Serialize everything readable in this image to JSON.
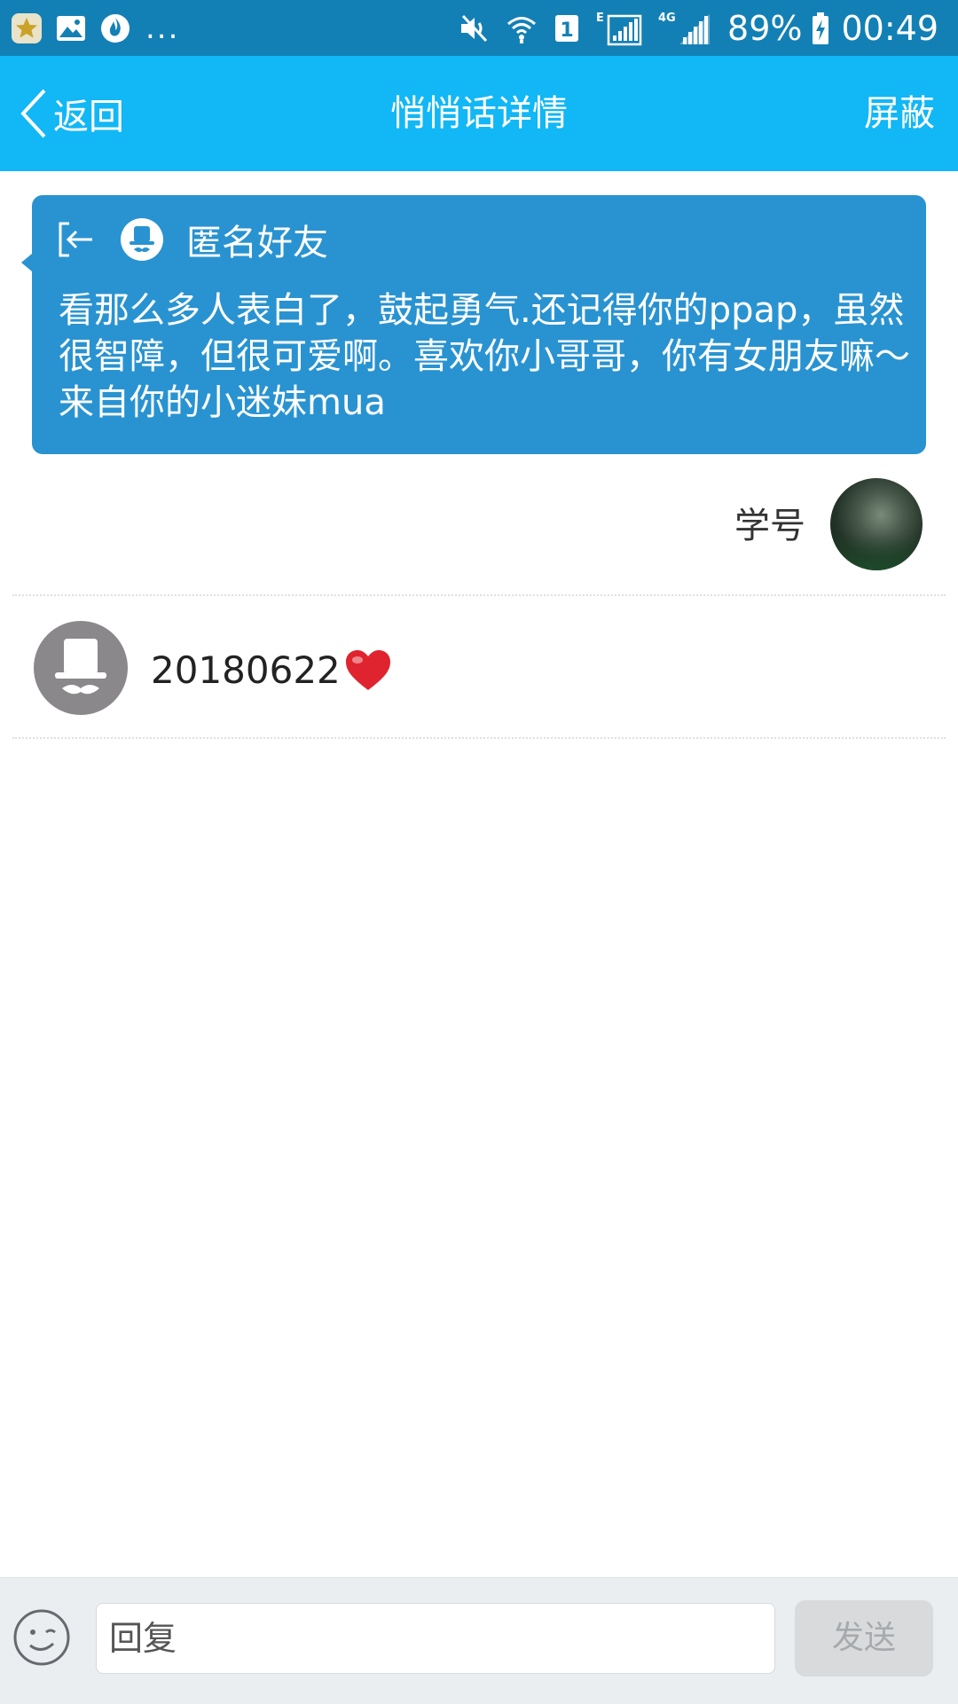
{
  "status_bar": {
    "left_icons": [
      "star-badge-icon",
      "image-icon",
      "flame-app-icon"
    ],
    "more": "...",
    "right_icons": [
      "mute-icon",
      "wifi-icon",
      "sim-1-icon",
      "signal-e-icon",
      "signal-4g-icon",
      "battery-charging-icon"
    ],
    "sim_label": "1",
    "network_e": "E",
    "network_4g": "4G",
    "battery": "89%",
    "time": "00:49"
  },
  "nav": {
    "back_label": "返回",
    "title": "悄悄话详情",
    "action_label": "屏蔽"
  },
  "message": {
    "sender_name": "匿名好友",
    "text": "看那么多人表白了，鼓起勇气.还记得你的ppap，虽然很智障，但很可爱啊。喜欢你小哥哥，你有女朋友嘛～来自你的小迷妹mua"
  },
  "recipient": {
    "label": "学号"
  },
  "reply": {
    "text": "20180622",
    "emoji": "heart-icon"
  },
  "input_bar": {
    "placeholder": "回复",
    "send_label": "发送"
  },
  "colors": {
    "status_bar": "#1380b5",
    "nav_bar": "#12b7f5",
    "card": "#2993d1",
    "heart": "#e0242f"
  }
}
